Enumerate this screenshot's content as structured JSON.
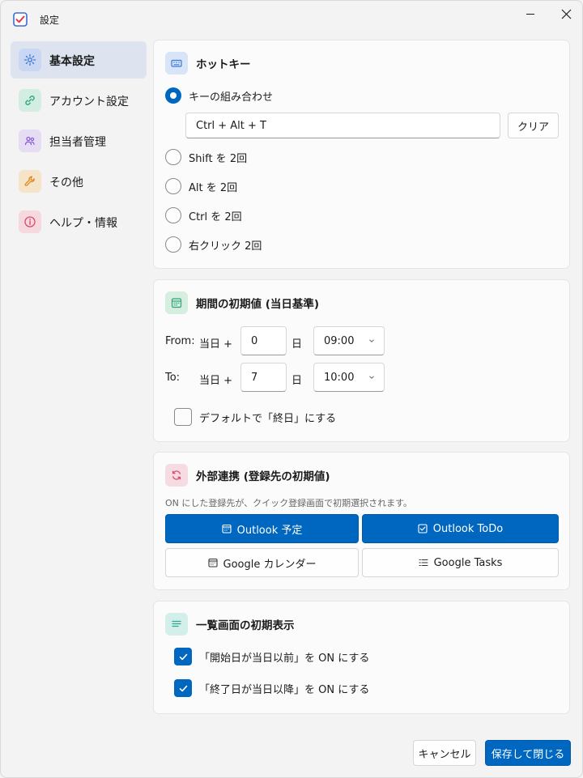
{
  "window": {
    "title": "設定"
  },
  "sidebar": {
    "items": [
      {
        "label": "基本設定",
        "icon": "gear-icon",
        "color": "#3b78d8",
        "bg": "#c9d7f3",
        "active": true
      },
      {
        "label": "アカウント設定",
        "icon": "link-icon",
        "color": "#2fa57a",
        "bg": "#d4ede2",
        "active": false
      },
      {
        "label": "担当者管理",
        "icon": "users-icon",
        "color": "#8a5cd6",
        "bg": "#e6dcf4",
        "active": false
      },
      {
        "label": "その他",
        "icon": "wrench-icon",
        "color": "#e08a1e",
        "bg": "#f6e4c8",
        "active": false
      },
      {
        "label": "ヘルプ・情報",
        "icon": "info-icon",
        "color": "#d94a6a",
        "bg": "#f6d9df",
        "active": false
      }
    ]
  },
  "hotkey": {
    "title": "ホットキー",
    "options": [
      "キーの組み合わせ",
      "Shift を 2回",
      "Alt を 2回",
      "Ctrl を 2回",
      "右クリック 2回"
    ],
    "selected_index": 0,
    "combo_value": "Ctrl + Alt + T",
    "clear_label": "クリア"
  },
  "period": {
    "title": "期間の初期値 (当日基準)",
    "from_label": "From:",
    "to_label": "To:",
    "today_plus": "当日 +",
    "day_unit": "日",
    "from_days": "0",
    "from_time": "09:00",
    "to_days": "7",
    "to_time": "10:00",
    "allday_label": "デフォルトで「終日」にする",
    "allday_checked": false
  },
  "integration": {
    "title": "外部連携 (登録先の初期値)",
    "description": "ON にした登録先が、クイック登録画面で初期選択されます。",
    "buttons": [
      {
        "label": "Outlook 予定",
        "icon": "calendar-icon",
        "on": true
      },
      {
        "label": "Outlook ToDo",
        "icon": "checkbox-icon",
        "on": true
      },
      {
        "label": "Google カレンダー",
        "icon": "calendar-icon",
        "on": false
      },
      {
        "label": "Google Tasks",
        "icon": "list-icon",
        "on": false
      }
    ]
  },
  "listview": {
    "title": "一覧画面の初期表示",
    "options": [
      {
        "label": "「開始日が当日以前」を ON にする",
        "checked": true
      },
      {
        "label": "「終了日が当日以降」を ON にする",
        "checked": true
      }
    ]
  },
  "footer": {
    "cancel_label": "キャンセル",
    "save_label": "保存して閉じる"
  },
  "colors": {
    "accent": "#0067c0"
  }
}
